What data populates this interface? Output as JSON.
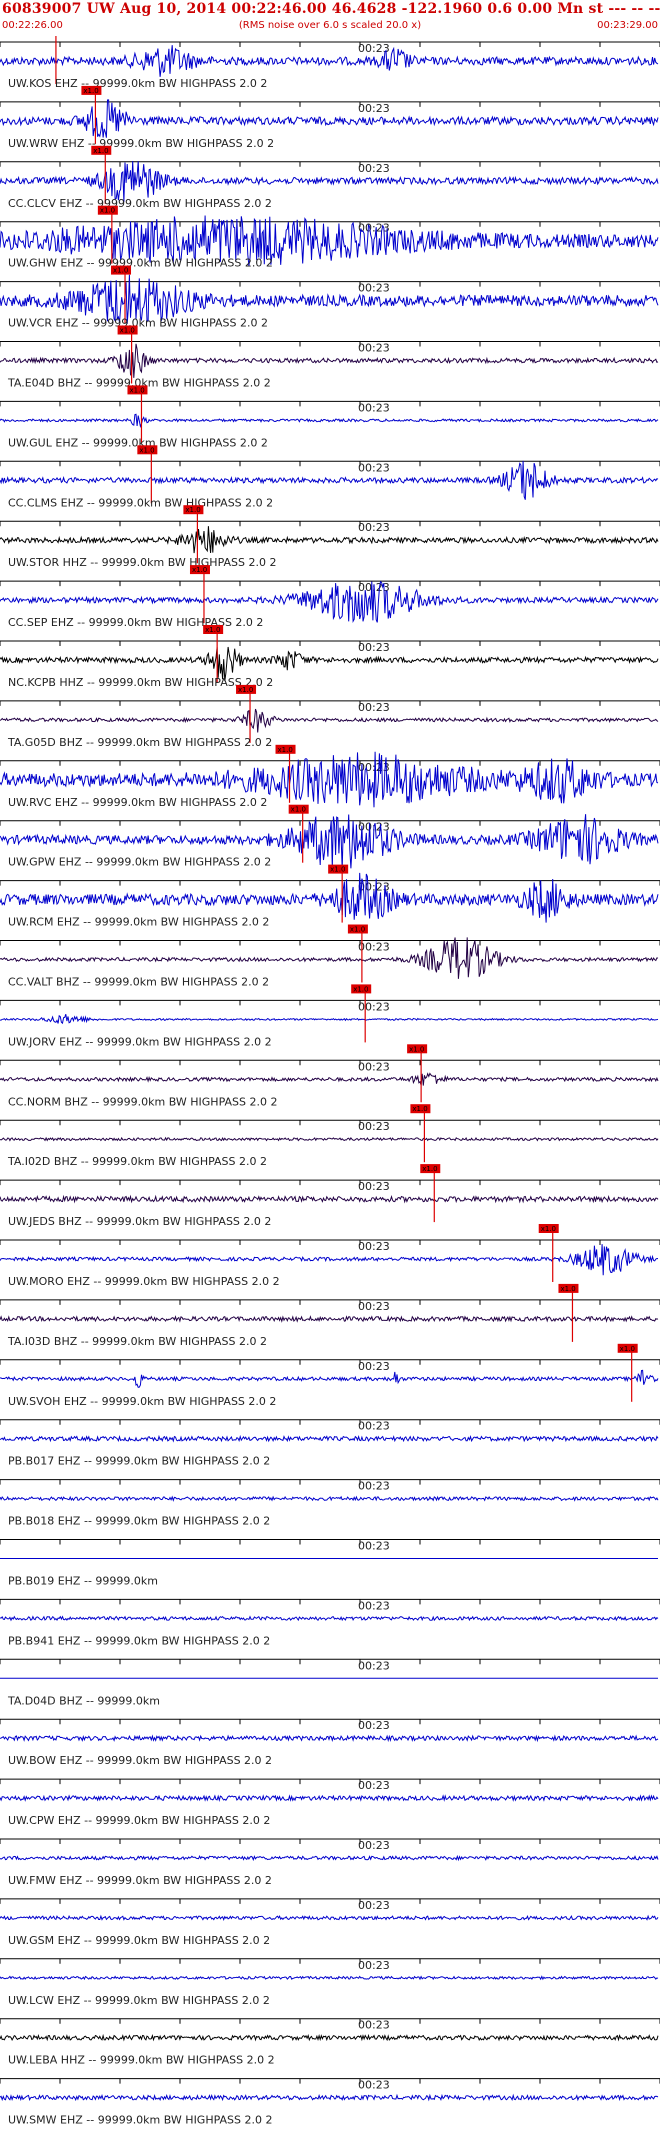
{
  "header": {
    "title": "60839007 UW Aug 10, 2014 00:22:46.00   46.4628 -122.1960  0.6 0.00 Mn st --- -- --   -1",
    "start_time": "00:22:26.00",
    "note": "(RMS noise over 6.0 s scaled 20.0 x)",
    "end_time": "00:23:29.00"
  },
  "time_mark": "00:23",
  "pick_label": "x1.0",
  "colors": {
    "header_text": "#cc0000",
    "trace_blue": "#0000cc",
    "trace_dark": "#220044",
    "trace_black": "#000000",
    "pick_marker": "#dd0000",
    "axis": "#000000"
  },
  "traces": [
    {
      "label": "UW.KOS EHZ -- 99999.0km BW  HIGHPASS  2.0  2",
      "pick": 0.085,
      "color": "trace_blue",
      "amp": 0.18,
      "bursts": [
        [
          0.25,
          0.04,
          0.6
        ],
        [
          0.6,
          0.02,
          0.5
        ]
      ]
    },
    {
      "label": "UW.WRW EHZ -- 99999.0km BW  HIGHPASS  2.0  2",
      "pick": 0.145,
      "color": "trace_blue",
      "amp": 0.18,
      "bursts": [
        [
          0.16,
          0.03,
          0.8
        ]
      ]
    },
    {
      "label": "CC.CLCV EHZ -- 99999.0km BW  HIGHPASS  2.0  2",
      "pick": 0.16,
      "color": "trace_blue",
      "amp": 0.15,
      "bursts": [
        [
          0.2,
          0.04,
          1.0
        ]
      ]
    },
    {
      "label": "UW.GHW EHZ -- 99999.0km BW  HIGHPASS  2.0  2",
      "pick": 0.17,
      "color": "trace_blue",
      "amp": 0.3,
      "bursts": [
        [
          0.35,
          0.25,
          0.9
        ]
      ]
    },
    {
      "label": "UW.VCR EHZ -- 99999.0km BW  HIGHPASS  2.0  2",
      "pick": 0.19,
      "color": "trace_blue",
      "amp": 0.25,
      "bursts": [
        [
          0.2,
          0.08,
          1.0
        ]
      ]
    },
    {
      "label": "TA.E04D BHZ -- 99999.0km BW  HIGHPASS  2.0  2",
      "pick": 0.2,
      "color": "trace_dark",
      "amp": 0.1,
      "bursts": [
        [
          0.2,
          0.02,
          0.8
        ]
      ]
    },
    {
      "label": "UW.GUL EHZ -- 99999.0km BW  HIGHPASS  2.0  2",
      "pick": 0.215,
      "color": "trace_blue",
      "amp": 0.06,
      "bursts": [
        [
          0.21,
          0.01,
          0.3
        ]
      ]
    },
    {
      "label": "CC.CLMS EHZ -- 99999.0km BW  HIGHPASS  2.0  2",
      "pick": 0.23,
      "color": "trace_blue",
      "amp": 0.12,
      "bursts": [
        [
          0.8,
          0.03,
          0.9
        ]
      ]
    },
    {
      "label": "UW.STOR HHZ -- 99999.0km BW  HIGHPASS  2.0  2",
      "pick": 0.3,
      "color": "trace_black",
      "amp": 0.12,
      "bursts": [
        [
          0.31,
          0.03,
          0.6
        ]
      ]
    },
    {
      "label": "CC.SEP EHZ -- 99999.0km BW  HIGHPASS  2.0  2",
      "pick": 0.31,
      "color": "trace_blue",
      "amp": 0.12,
      "bursts": [
        [
          0.55,
          0.08,
          1.0
        ]
      ]
    },
    {
      "label": "NC.KCPB HHZ -- 99999.0km BW  HIGHPASS  2.0  2",
      "pick": 0.33,
      "color": "trace_black",
      "amp": 0.12,
      "bursts": [
        [
          0.34,
          0.02,
          0.9
        ],
        [
          0.44,
          0.02,
          0.4
        ]
      ]
    },
    {
      "label": "TA.G05D BHZ -- 99999.0km BW  HIGHPASS  2.0  2",
      "pick": 0.38,
      "color": "trace_dark",
      "amp": 0.08,
      "bursts": [
        [
          0.39,
          0.02,
          0.5
        ]
      ]
    },
    {
      "label": "UW.RVC EHZ -- 99999.0km BW  HIGHPASS  2.0  2",
      "pick": 0.44,
      "color": "trace_blue",
      "amp": 0.3,
      "bursts": [
        [
          0.55,
          0.15,
          1.0
        ],
        [
          0.85,
          0.05,
          0.8
        ]
      ]
    },
    {
      "label": "UW.GPW EHZ -- 99999.0km BW  HIGHPASS  2.0  2",
      "pick": 0.46,
      "color": "trace_blue",
      "amp": 0.2,
      "bursts": [
        [
          0.52,
          0.07,
          1.2
        ],
        [
          0.88,
          0.06,
          1.0
        ]
      ]
    },
    {
      "label": "UW.RCM EHZ -- 99999.0km BW  HIGHPASS  2.0  2",
      "pick": 0.52,
      "color": "trace_blue",
      "amp": 0.25,
      "bursts": [
        [
          0.55,
          0.04,
          1.0
        ],
        [
          0.83,
          0.03,
          0.8
        ]
      ]
    },
    {
      "label": "CC.VALT BHZ -- 99999.0km BW  HIGHPASS  2.0  2",
      "pick": 0.55,
      "color": "trace_dark",
      "amp": 0.08,
      "bursts": [
        [
          0.7,
          0.05,
          1.0
        ]
      ]
    },
    {
      "label": "UW.JORV EHZ -- 99999.0km BW  HIGHPASS  2.0  2",
      "pick": 0.555,
      "color": "trace_blue",
      "amp": 0.04,
      "bursts": [
        [
          0.1,
          0.03,
          0.2
        ]
      ]
    },
    {
      "label": "CC.NORM BHZ -- 99999.0km BW  HIGHPASS  2.0  2",
      "pick": 0.64,
      "color": "trace_dark",
      "amp": 0.08,
      "bursts": [
        [
          0.65,
          0.02,
          0.3
        ]
      ]
    },
    {
      "label": "TA.I02D BHZ -- 99999.0km BW  HIGHPASS  2.0  2",
      "pick": 0.645,
      "color": "trace_dark",
      "amp": 0.06,
      "bursts": []
    },
    {
      "label": "UW.JEDS BHZ -- 99999.0km BW  HIGHPASS  2.0  2",
      "pick": 0.66,
      "color": "trace_dark",
      "amp": 0.12,
      "bursts": []
    },
    {
      "label": "UW.MORO EHZ -- 99999.0km BW  HIGHPASS  2.0  2",
      "pick": 0.84,
      "color": "trace_blue",
      "amp": 0.08,
      "bursts": [
        [
          0.92,
          0.04,
          0.7
        ]
      ]
    },
    {
      "label": "TA.I03D BHZ -- 99999.0km BW  HIGHPASS  2.0  2",
      "pick": 0.87,
      "color": "trace_dark",
      "amp": 0.1,
      "bursts": []
    },
    {
      "label": "UW.SVOH EHZ -- 99999.0km BW  HIGHPASS  2.0  2",
      "pick": 0.96,
      "color": "trace_blue",
      "amp": 0.08,
      "bursts": [
        [
          0.21,
          0.005,
          0.5
        ],
        [
          0.6,
          0.005,
          0.4
        ],
        [
          0.98,
          0.01,
          0.5
        ]
      ]
    },
    {
      "label": "PB.B017 EHZ -- 99999.0km BW  HIGHPASS  2.0  2",
      "pick": null,
      "color": "trace_blue",
      "amp": 0.1,
      "bursts": []
    },
    {
      "label": "PB.B018 EHZ -- 99999.0km BW  HIGHPASS  2.0  2",
      "pick": null,
      "color": "trace_blue",
      "amp": 0.08,
      "bursts": []
    },
    {
      "label": "PB.B019 EHZ -- 99999.0km",
      "pick": null,
      "color": "trace_blue",
      "amp": 0.0,
      "bursts": []
    },
    {
      "label": "PB.B941 EHZ -- 99999.0km BW  HIGHPASS  2.0  2",
      "pick": null,
      "color": "trace_blue",
      "amp": 0.08,
      "bursts": []
    },
    {
      "label": "TA.D04D BHZ -- 99999.0km",
      "pick": null,
      "color": "trace_blue",
      "amp": 0.0,
      "bursts": []
    },
    {
      "label": "UW.BOW EHZ -- 99999.0km BW  HIGHPASS  2.0  2",
      "pick": null,
      "color": "trace_blue",
      "amp": 0.1,
      "bursts": []
    },
    {
      "label": "UW.CPW EHZ -- 99999.0km BW  HIGHPASS  2.0  2",
      "pick": null,
      "color": "trace_blue",
      "amp": 0.1,
      "bursts": []
    },
    {
      "label": "UW.FMW EHZ -- 99999.0km BW  HIGHPASS  2.0  2",
      "pick": null,
      "color": "trace_blue",
      "amp": 0.08,
      "bursts": []
    },
    {
      "label": "UW.GSM EHZ -- 99999.0km BW  HIGHPASS  2.0  2",
      "pick": null,
      "color": "trace_blue",
      "amp": 0.08,
      "bursts": []
    },
    {
      "label": "UW.LCW EHZ -- 99999.0km BW  HIGHPASS  2.0  2",
      "pick": null,
      "color": "trace_blue",
      "amp": 0.06,
      "bursts": []
    },
    {
      "label": "UW.LEBA HHZ -- 99999.0km BW  HIGHPASS  2.0  2",
      "pick": null,
      "color": "trace_black",
      "amp": 0.1,
      "bursts": []
    },
    {
      "label": "UW.SMW EHZ -- 99999.0km BW  HIGHPASS  2.0  2",
      "pick": null,
      "color": "trace_blue",
      "amp": 0.1,
      "bursts": []
    }
  ]
}
